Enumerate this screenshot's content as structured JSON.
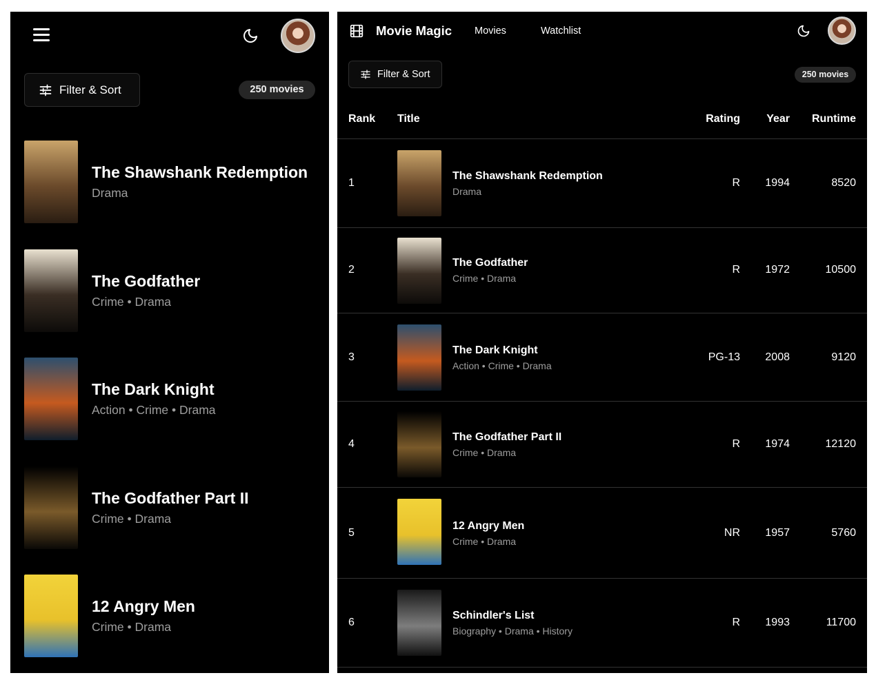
{
  "app": {
    "title": "Movie Magic"
  },
  "nav": [
    {
      "label": "Movies"
    },
    {
      "label": "Watchlist"
    }
  ],
  "toolbar": {
    "filter_label": "Filter & Sort",
    "count_label": "250 movies"
  },
  "table": {
    "headers": {
      "rank": "Rank",
      "title": "Title",
      "rating": "Rating",
      "year": "Year",
      "runtime": "Runtime"
    }
  },
  "movies": [
    {
      "rank": "1",
      "title": "The Shawshank Redemption",
      "genres": "Drama",
      "rating": "R",
      "year": "1994",
      "runtime": "8520",
      "poster": {
        "top": "#c9a46a",
        "mid": "#6b4a2b",
        "bottom": "#2a1d12"
      }
    },
    {
      "rank": "2",
      "title": "The Godfather",
      "genres": "Crime • Drama",
      "rating": "R",
      "year": "1972",
      "runtime": "10500",
      "poster": {
        "top": "#e9e1d0",
        "mid": "#3a2e24",
        "bottom": "#0d0b09"
      }
    },
    {
      "rank": "3",
      "title": "The Dark Knight",
      "genres": "Action • Crime • Drama",
      "rating": "PG-13",
      "year": "2008",
      "runtime": "9120",
      "poster": {
        "top": "#2d4f6e",
        "mid": "#c55a1f",
        "bottom": "#0f1e2c"
      }
    },
    {
      "rank": "4",
      "title": "The Godfather Part II",
      "genres": "Crime • Drama",
      "rating": "R",
      "year": "1974",
      "runtime": "12120",
      "poster": {
        "top": "#000000",
        "mid": "#7a5a2a",
        "bottom": "#0b0906"
      }
    },
    {
      "rank": "5",
      "title": "12 Angry Men",
      "genres": "Crime • Drama",
      "rating": "NR",
      "year": "1957",
      "runtime": "5760",
      "poster": {
        "top": "#f2d33a",
        "mid": "#e8c12b",
        "bottom": "#2f73b7"
      }
    },
    {
      "rank": "6",
      "title": "Schindler's List",
      "genres": "Biography • Drama • History",
      "rating": "R",
      "year": "1993",
      "runtime": "11700",
      "poster": {
        "top": "#1a1a1a",
        "mid": "#7d7d7d",
        "bottom": "#111111"
      }
    }
  ]
}
